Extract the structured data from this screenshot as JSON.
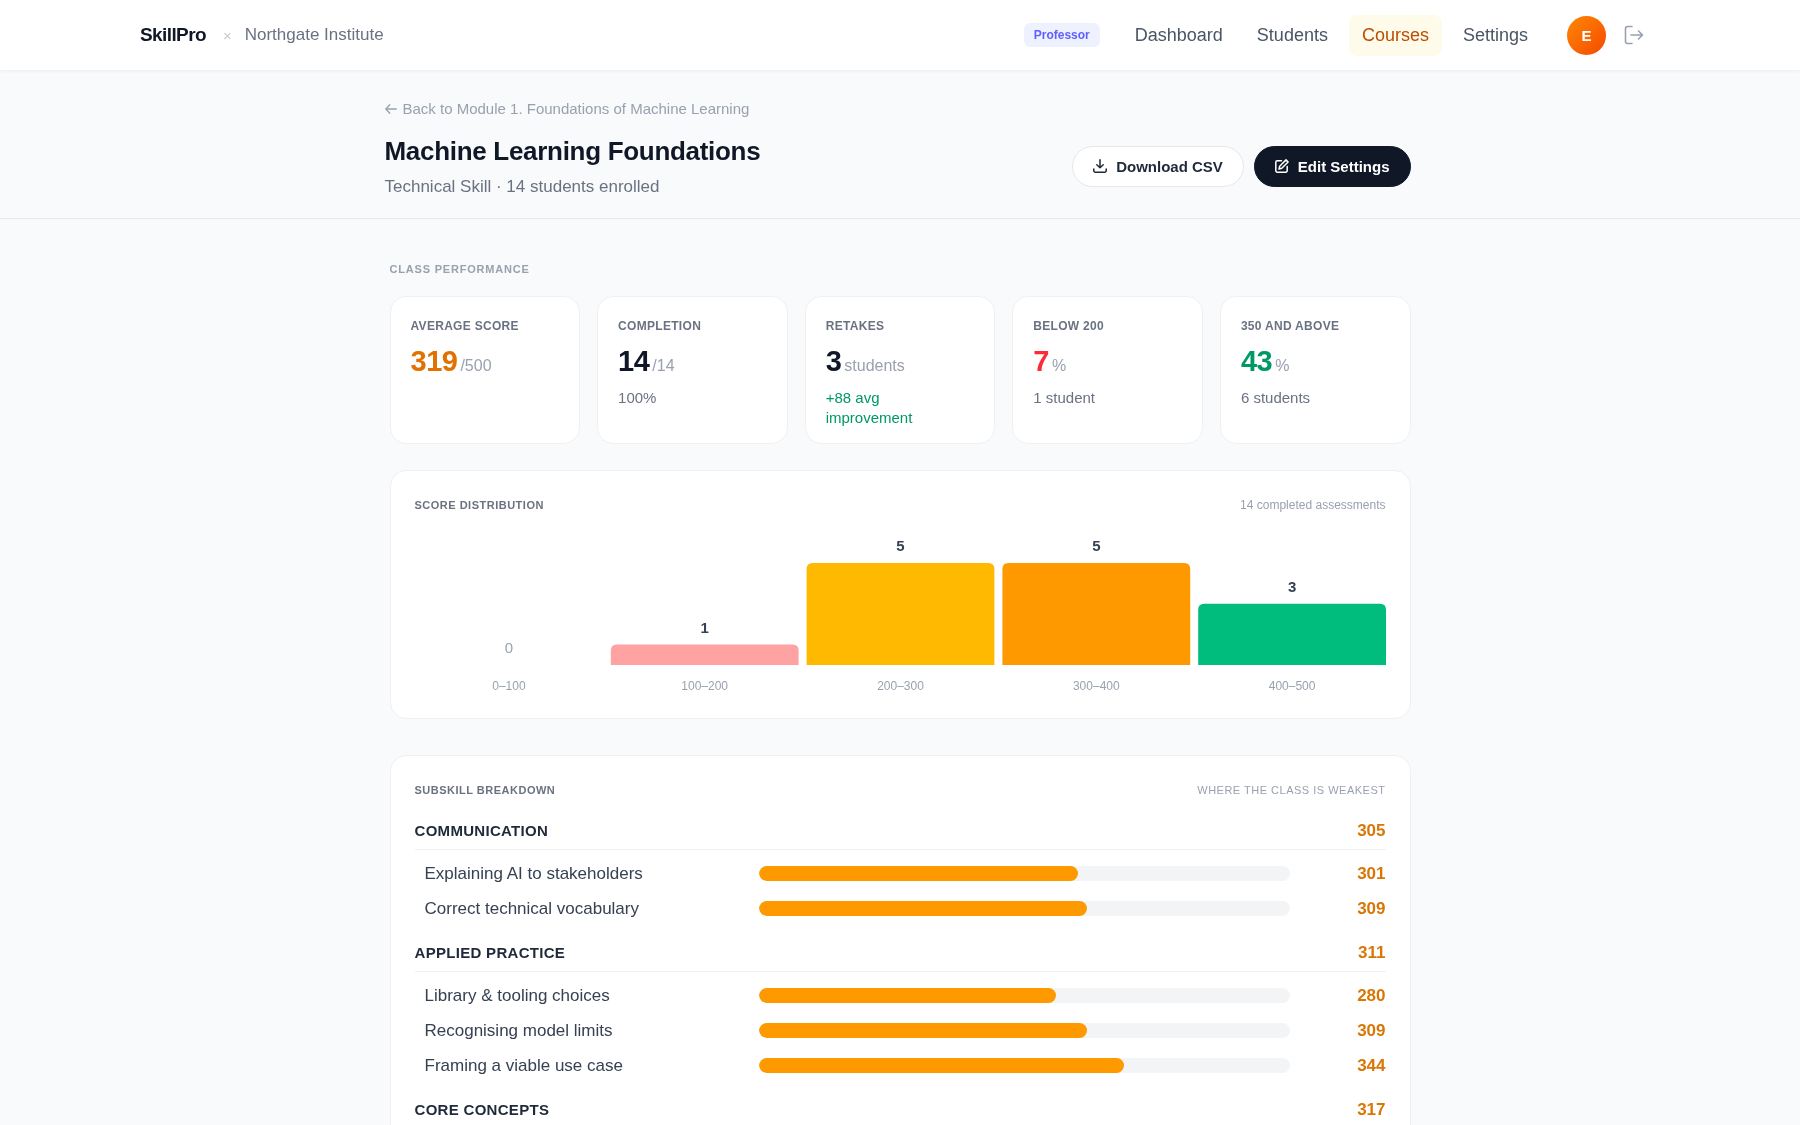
{
  "header": {
    "logo": "SkillPro",
    "separator": "×",
    "institution": "Northgate Institute",
    "role_badge": "Professor",
    "nav": [
      {
        "label": "Dashboard",
        "selected": false
      },
      {
        "label": "Students",
        "selected": false
      },
      {
        "label": "Courses",
        "selected": true
      },
      {
        "label": "Settings",
        "selected": false
      }
    ],
    "avatar_initial": "E"
  },
  "page": {
    "back_link": "Back to Module 1. Foundations of Machine Learning",
    "title": "Machine Learning Foundations",
    "subtitle": "Technical Skill · 14 students enrolled",
    "actions": [
      {
        "label": "Download CSV",
        "kind": "download"
      },
      {
        "label": "Edit Settings",
        "kind": "edit"
      }
    ]
  },
  "class_performance": {
    "heading": "CLASS PERFORMANCE",
    "stats": [
      {
        "label": "AVERAGE SCORE",
        "value": "319",
        "unit": "/500",
        "color": "#e17100"
      },
      {
        "label": "COMPLETION",
        "value": "14",
        "unit": "/14",
        "color": "#101828",
        "note": "100%",
        "positive": false
      },
      {
        "label": "RETAKES",
        "value": "3",
        "unit": "students",
        "color": "#101828",
        "note": "+88 avg improvement",
        "positive": true
      },
      {
        "label": "BELOW 200",
        "value": "7",
        "unit": "%",
        "color": "#fb2c36",
        "note": "1 student",
        "positive": false
      },
      {
        "label": "350 AND ABOVE",
        "value": "43",
        "unit": "%",
        "color": "#009966",
        "note": "6 students",
        "positive": false
      }
    ]
  },
  "score_distribution": {
    "meta": "14 completed assessments",
    "chart_data": {
      "type": "bar",
      "title": "SCORE DISTRIBUTION",
      "categories": [
        "0–100",
        "100–200",
        "200–300",
        "300–400",
        "400–500"
      ],
      "values": [
        0,
        1,
        5,
        5,
        3
      ],
      "colors": [
        "#99a1af",
        "#ffa2a2",
        "#ffb900",
        "#fe9a00",
        "#00bc7d"
      ],
      "data_labels": true
    }
  },
  "subskills": {
    "heading": "SUBSKILL BREAKDOWN",
    "note": "WHERE THE CLASS IS WEAKEST",
    "groups": [
      {
        "name": "COMMUNICATION",
        "score": "305",
        "children": [
          {
            "name": "Explaining AI to stakeholders",
            "level": 0.602,
            "score": "301"
          },
          {
            "name": "Correct technical vocabulary",
            "level": 0.618,
            "score": "309"
          }
        ]
      },
      {
        "name": "APPLIED PRACTICE",
        "score": "311",
        "children": [
          {
            "name": "Library & tooling choices",
            "level": 0.56,
            "score": "280"
          },
          {
            "name": "Recognising model limits",
            "level": 0.618,
            "score": "309"
          },
          {
            "name": "Framing a viable use case",
            "level": 0.688,
            "score": "344"
          }
        ]
      },
      {
        "name": "CORE CONCEPTS",
        "score": "317"
      }
    ]
  }
}
